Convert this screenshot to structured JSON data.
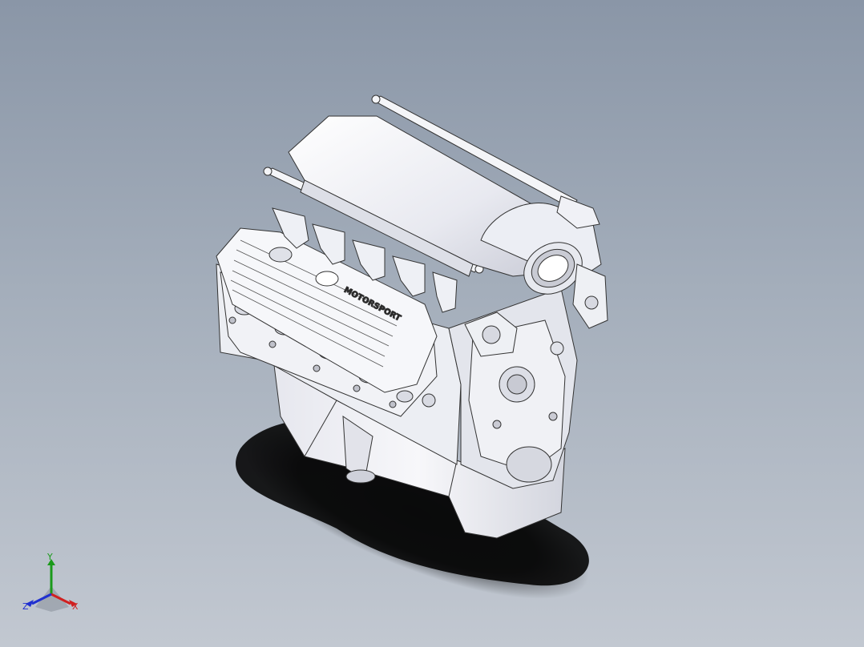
{
  "viewport": {
    "background_top": "#8a96a7",
    "background_bottom": "#c2c8d1",
    "model": {
      "name": "V8 engine assembly",
      "valve_cover_text": "MOTORSPORT",
      "shading": "shaded-with-edges",
      "part_color": "#f2f3f7",
      "edge_color": "#222222"
    }
  },
  "triad": {
    "x_label": "X",
    "y_label": "Y",
    "z_label": "Z",
    "x_color": "#d02020",
    "y_color": "#1a9a1a",
    "z_color": "#2030d0"
  }
}
